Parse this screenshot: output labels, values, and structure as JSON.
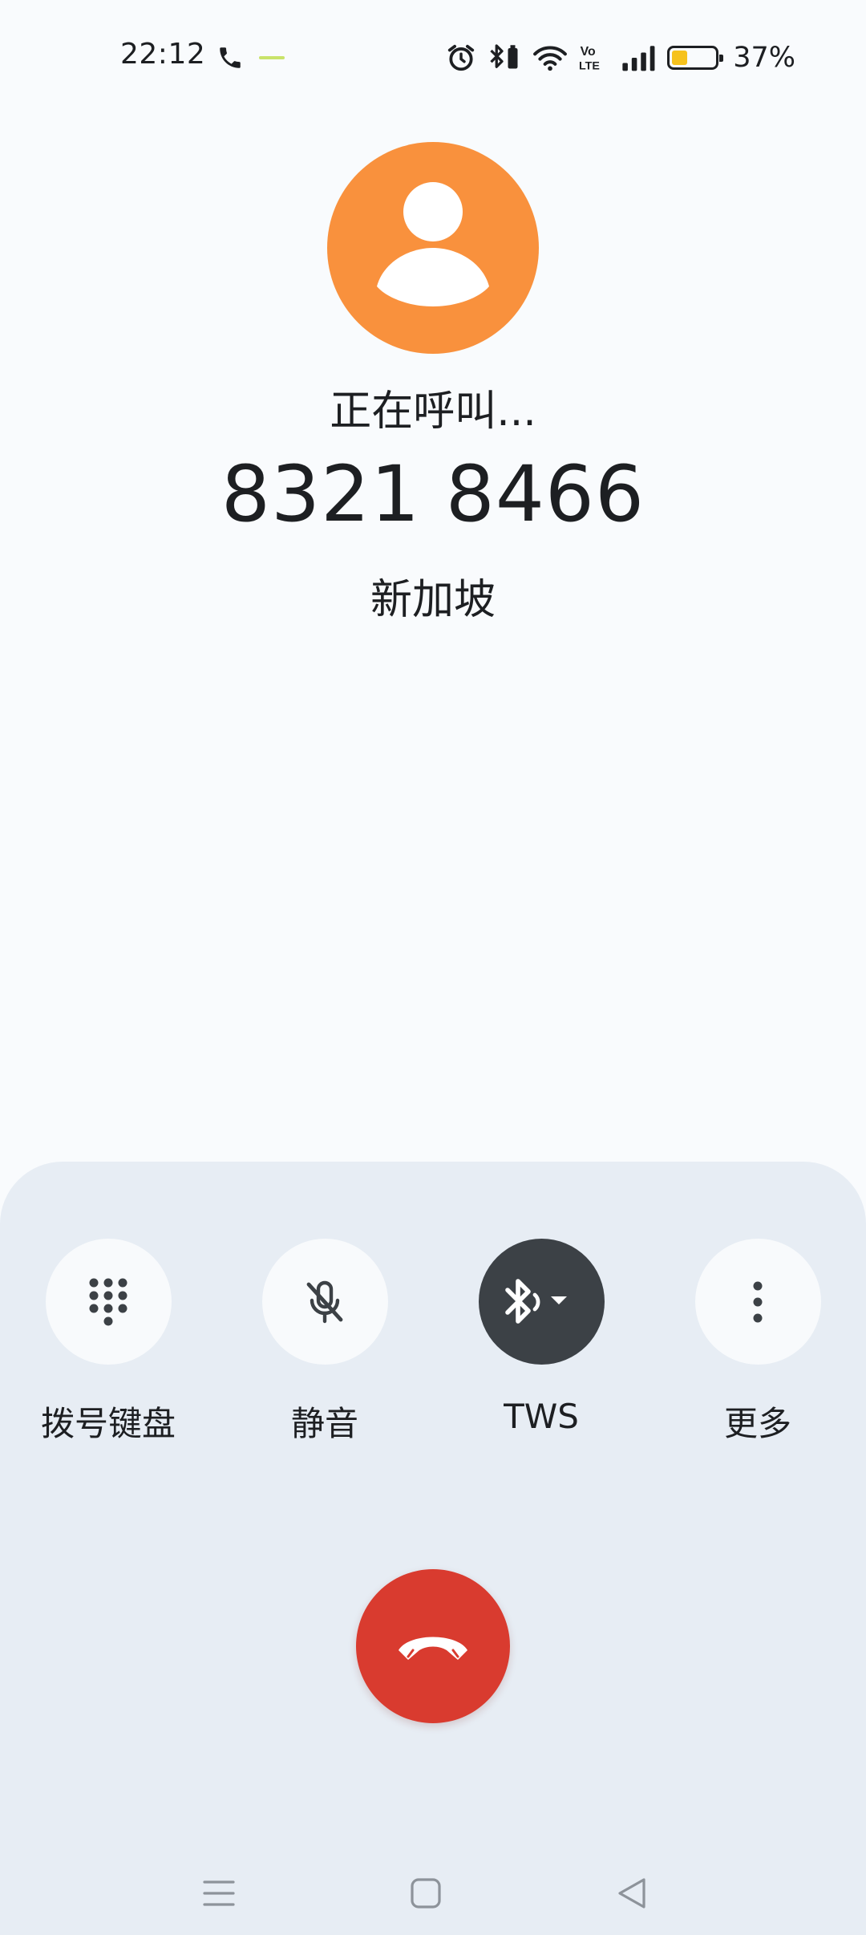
{
  "status_bar": {
    "time": "22:12",
    "battery_text": "37%",
    "battery_level": 0.37,
    "icons": [
      "phone-icon",
      "alarm-icon",
      "bluetooth-battery-icon",
      "wifi-icon",
      "volte-icon",
      "signal-icon",
      "battery-icon"
    ]
  },
  "call": {
    "status": "正在呼叫...",
    "number": "8321 8466",
    "location": "新加坡",
    "avatar_color": "#f9913d"
  },
  "actions": [
    {
      "label": "拨号键盘",
      "icon": "dialpad-icon"
    },
    {
      "label": "静音",
      "icon": "mute-icon"
    },
    {
      "label": "TWS",
      "icon": "bluetooth-audio-icon"
    },
    {
      "label": "更多",
      "icon": "more-vertical-icon"
    }
  ],
  "end_call": {
    "icon": "end-call-icon",
    "color": "#d93b2f"
  },
  "nav": {
    "icons": [
      "menu-icon",
      "home-icon",
      "back-icon"
    ]
  }
}
